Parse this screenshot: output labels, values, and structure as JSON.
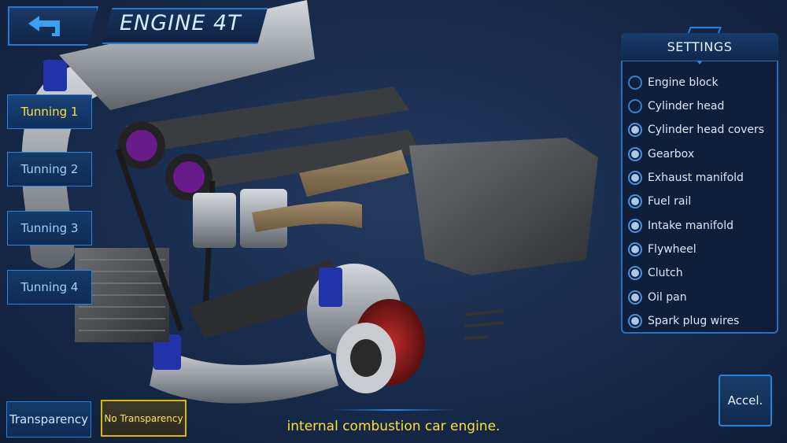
{
  "header": {
    "title": "ENGINE 4T",
    "back_icon": "back-arrow-icon"
  },
  "tuning_buttons": [
    {
      "label": "Tunning 1",
      "active": true
    },
    {
      "label": "Tunning 2",
      "active": false
    },
    {
      "label": "Tunning 3",
      "active": false
    },
    {
      "label": "Tunning 4",
      "active": false
    }
  ],
  "settings": {
    "title": "SETTINGS",
    "options": [
      {
        "label": "Engine block",
        "checked": false
      },
      {
        "label": "Cylinder head",
        "checked": false
      },
      {
        "label": "Cylinder head covers",
        "checked": true
      },
      {
        "label": "Gearbox",
        "checked": true
      },
      {
        "label": "Exhaust manifold",
        "checked": true
      },
      {
        "label": "Fuel rail",
        "checked": true
      },
      {
        "label": "Intake manifold",
        "checked": true
      },
      {
        "label": "Flywheel",
        "checked": true
      },
      {
        "label": "Clutch",
        "checked": true
      },
      {
        "label": "Oil pan",
        "checked": true
      },
      {
        "label": "Spark plug wires",
        "checked": true
      }
    ]
  },
  "bottom": {
    "transparency_label": "Transparency",
    "no_transparency_label": "No Transparency",
    "caption": "internal combustion car engine.",
    "accel_label": "Accel."
  },
  "colors": {
    "accent_blue": "#2b82d8",
    "active_yellow": "#ffe030",
    "background": "#172a4a"
  }
}
